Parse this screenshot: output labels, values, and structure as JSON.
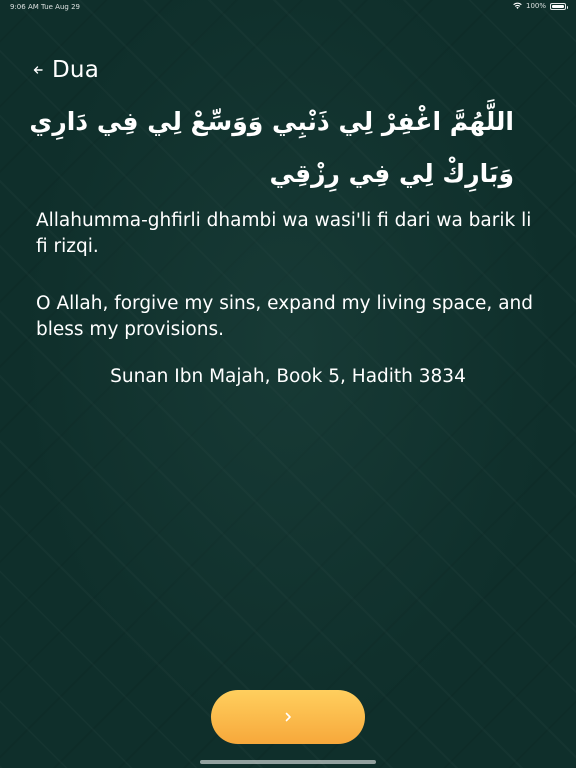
{
  "status_bar": {
    "time_date": "9:06 AM   Tue Aug 29",
    "battery": "100%",
    "battery_level": 1.0
  },
  "header": {
    "title": "Dua",
    "back_icon": "arrow-left-icon"
  },
  "dua": {
    "arabic": "اللَّهُمَّ اغْفِرْ لِي ذَنْبِي وَوَسِّعْ لِي فِي دَارِي وَبَارِكْ لِي فِي رِزْقِي",
    "transliteration": "Allahumma-ghfirli dhambi wa wasi'li fi dari wa barik li fi rizqi.",
    "translation": "O Allah, forgive my sins, expand my living space, and bless my provisions.",
    "reference": "Sunan Ibn Majah, Book 5, Hadith 3834"
  },
  "next_button": {
    "icon": "chevron-right-icon"
  },
  "colors": {
    "background": "#0f2f2b",
    "button_top": "#ffcf5e",
    "button_bottom": "#f7a83b",
    "text": "#ffffff"
  }
}
